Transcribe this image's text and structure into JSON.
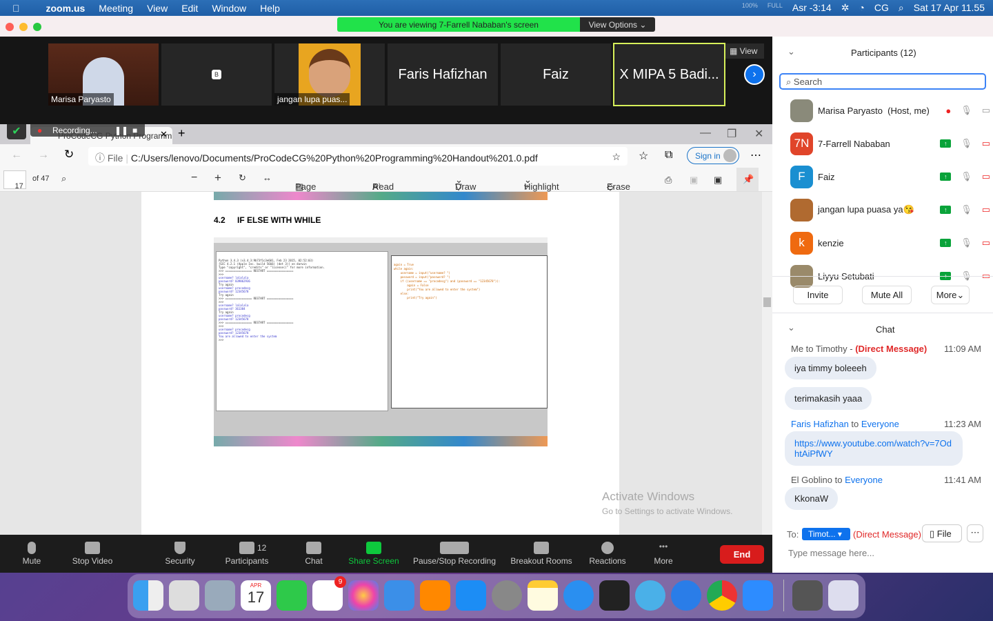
{
  "menubar": {
    "app": "zoom.us",
    "items": [
      "Meeting",
      "View",
      "Edit",
      "Window",
      "Help"
    ],
    "battery_pct": "100%",
    "battery_state": "FULL",
    "prayer": "Asr -3:14",
    "input": "CG",
    "datetime": "Sat 17 Apr  11.55"
  },
  "banner": {
    "text": "You are viewing 7-Farrell Nababan's screen",
    "view_options": "View Options"
  },
  "videos": {
    "tiles": [
      {
        "name": "Marisa Paryasto"
      },
      {
        "name": "B"
      },
      {
        "name": "jangan lupa puas..."
      },
      {
        "name": "Faris Hafizhan"
      },
      {
        "name": "Faiz"
      },
      {
        "name": "X MIPA 5 Badi..."
      }
    ],
    "view_label": "View"
  },
  "browser": {
    "recording": "Recording...",
    "tab_title": "ProCodeCG Python Programming",
    "file_label": "File",
    "url": "C:/Users/lenovo/Documents/ProCodeCG%20Python%20Programming%20Handout%201.0.pdf",
    "sign_in": "Sign in",
    "pdf": {
      "page": "17",
      "of": "of 47",
      "page_view": "Page view",
      "read_aloud": "Read aloud",
      "draw": "Draw",
      "highlight": "Highlight",
      "erase": "Erase",
      "heading_num": "4.2",
      "heading": "IF ELSE WITH WHILE",
      "activate_title": "Activate Windows",
      "activate_sub": "Go to Settings to activate Windows.",
      "shell_lines": [
        "Python 3.4.3 (v3.4.3:9b73f1c3e601, Feb 23 2015, 02:52:03)",
        "[GCC 4.2.1 (Apple Inc. build 5666) (dot 3)] on darwin",
        "Type \"copyright\", \"credits\" or \"license()\" for more information.",
        ">>> ================ RESTART ================",
        ">>>",
        "username? lalalala",
        "password? 839862936",
        "Try again",
        "username? procodecg",
        "password? 12345678",
        "Try again",
        ">>> ================ RESTART ================",
        ">>>",
        "username? lalalala",
        "password? 361384",
        "Try again",
        "username? procodecg",
        "password? 12345678",
        ">>> ================ RESTART ================",
        ">>>",
        "username? procodecg",
        "password? 12345678",
        "You are allowed to enter the system",
        ">>>"
      ],
      "code_lines": [
        "again = True",
        "while again:",
        "    username = input(\"username? \")",
        "    password = input(\"password? \")",
        "    if ((username == \"procodecg\") and (password == \"12345678\")):",
        "        again = False",
        "        print(\"You are allowed to enter the system\")",
        "    else:",
        "        print(\"Try again\")"
      ]
    }
  },
  "zoom_toolbar": {
    "mute": "Mute",
    "stop_video": "Stop Video",
    "security": "Security",
    "participants": "Participants",
    "participants_count": "12",
    "chat": "Chat",
    "share_screen": "Share Screen",
    "recording": "Pause/Stop Recording",
    "breakout": "Breakout Rooms",
    "reactions": "Reactions",
    "more": "More",
    "end": "End"
  },
  "participants": {
    "title": "Participants (12)",
    "search_placeholder": "Search",
    "list": [
      {
        "initials": "",
        "name": "Marisa Paryasto",
        "role": "(Host, me)",
        "color": "#8a8a7a"
      },
      {
        "initials": "7N",
        "name": "7-Farrell Nababan",
        "color": "#e0452a"
      },
      {
        "initials": "F",
        "name": "Faiz",
        "color": "#1a8fd1"
      },
      {
        "initials": "",
        "name": "jangan lupa puasa ya😘",
        "color": "#b06a30"
      },
      {
        "initials": "k",
        "name": "kenzie",
        "color": "#ef6a10"
      },
      {
        "initials": "",
        "name": "Liyyu Setubati",
        "color": "#9a8a6a"
      }
    ],
    "invite": "Invite",
    "mute_all": "Mute All",
    "more": "More"
  },
  "chat": {
    "title": "Chat",
    "messages": [
      {
        "from": "Me to Timothy - ",
        "to": "(Direct Message)",
        "time": "11:09 AM",
        "texts": [
          "iya timmy boleeeh",
          "terimakasih yaaa"
        ]
      },
      {
        "from": "Faris Hafizhan",
        "to": "Everyone",
        "time": "11:23 AM",
        "texts": [
          "https://www.youtube.com/watch?v=7OdhtAiPfWY"
        ]
      },
      {
        "from": "El Goblino",
        "to": "Everyone",
        "time": "11:41 AM",
        "texts": [
          "KkonaW"
        ]
      }
    ],
    "to_label": "To:",
    "recipient": "Timot...",
    "dm": "(Direct Message)",
    "file": "File",
    "placeholder": "Type message here..."
  },
  "dock": {
    "calendar_month": "APR",
    "calendar_day": "17",
    "reminders_badge": "9"
  },
  "colors": {
    "zoom_blue": "#0e72ed",
    "end_red": "#e02828",
    "share_green": "#0ec93d",
    "banner_green": "#21e24a"
  }
}
